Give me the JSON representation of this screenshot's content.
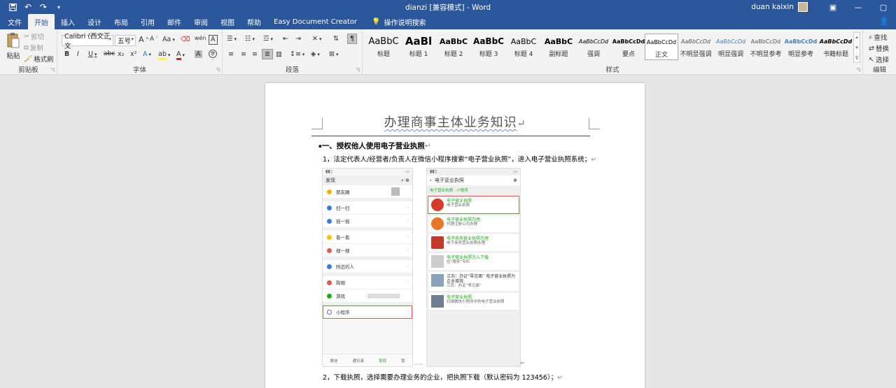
{
  "titlebar": {
    "title": "dianzi  [兼容模式]  -  Word",
    "user": "duan kaixin"
  },
  "tabs": [
    "文件",
    "开始",
    "插入",
    "设计",
    "布局",
    "引用",
    "邮件",
    "审阅",
    "视图",
    "帮助",
    "Easy Document Creator"
  ],
  "tell_me": "操作说明搜索",
  "clipboard": {
    "paste": "粘贴",
    "cut": "剪切",
    "copy": "复制",
    "painter": "格式刷",
    "label": "剪贴板"
  },
  "font": {
    "name": "Calibri (西文正文",
    "size": "五号",
    "label": "字体",
    "aa": "Aa",
    "bold": "B",
    "italic": "I",
    "underline": "U",
    "strike": "abc",
    "sub": "x₂",
    "sup": "x²",
    "font_color": "A",
    "char_shade": "A",
    "grow": "A",
    "shrink": "A",
    "clear": "A",
    "phonetic": "wén",
    "border": "A"
  },
  "paragraph": {
    "label": "段落"
  },
  "styles": {
    "label": "样式",
    "items": [
      {
        "preview": "AaBbC",
        "name": "标题"
      },
      {
        "preview": "AaBl",
        "name": "标题 1"
      },
      {
        "preview": "AaBbC",
        "name": "标题 2"
      },
      {
        "preview": "AaBbC",
        "name": "标题 3"
      },
      {
        "preview": "AaBbC",
        "name": "标题 4"
      },
      {
        "preview": "AaBbC",
        "name": "副标题"
      },
      {
        "preview": "AaBbCcDd",
        "name": "强调"
      },
      {
        "preview": "AaBbCcDd",
        "name": "要点"
      },
      {
        "preview": "AaBbCcDd",
        "name": "正文"
      },
      {
        "preview": "AaBbCcDd",
        "name": "不明显强调"
      },
      {
        "preview": "AaBbCcDd",
        "name": "明显强调"
      },
      {
        "preview": "AaBbCcDd",
        "name": "不明显参考"
      },
      {
        "preview": "AaBbCcDd",
        "name": "明显参考"
      },
      {
        "preview": "AaBbCcDd",
        "name": "书籍标题"
      }
    ]
  },
  "editing": {
    "find": "查找",
    "replace": "替换",
    "select": "选择",
    "label": "编辑"
  },
  "document": {
    "title": "办理商事主体业务知识",
    "heading": "一、授权他人使用电子营业执照",
    "para1": "1，法定代表人/经营者/负责人在微信小程序搜索“电子营业执照”，进入电子营业执照系统；",
    "para2": "2，下载执照，选择需要办理业务的企业，把执照下载（默认密码为 123456）；"
  },
  "phone_left": {
    "header": "发现",
    "rows": [
      "朋友圈",
      "扫一扫",
      "摇一摇",
      "看一看",
      "搜一搜",
      "附近的人",
      "购物",
      "游戏",
      "小程序"
    ],
    "tabbar": [
      "微信",
      "通讯录",
      "发现",
      "我"
    ]
  },
  "phone_right": {
    "header": "电子营业执照",
    "section": "电子营业执照 · 小程序",
    "cards": [
      {
        "title": "电子营业执照",
        "desc": "电子营业执照"
      },
      {
        "title": "电子营业执照办理",
        "desc": "代理注册公司办理"
      },
      {
        "title": "电子商务营业执照办理",
        "desc": "电子商务营业执照办理"
      },
      {
        "title": "电子营业执照怎么下载",
        "desc": "在“服务”专栏"
      },
      {
        "title": "江苏：办证“零见面” 电子营业执照为企业增效",
        "desc": "江苏：办证“零见面”"
      },
      {
        "title": "电子营业执照",
        "desc": "扫描微信小程序中的电子营业执照"
      }
    ]
  },
  "colors": {
    "accent": "#2b579a",
    "highlight_red": "#e05a4e",
    "wechat_green": "#1aad19"
  }
}
